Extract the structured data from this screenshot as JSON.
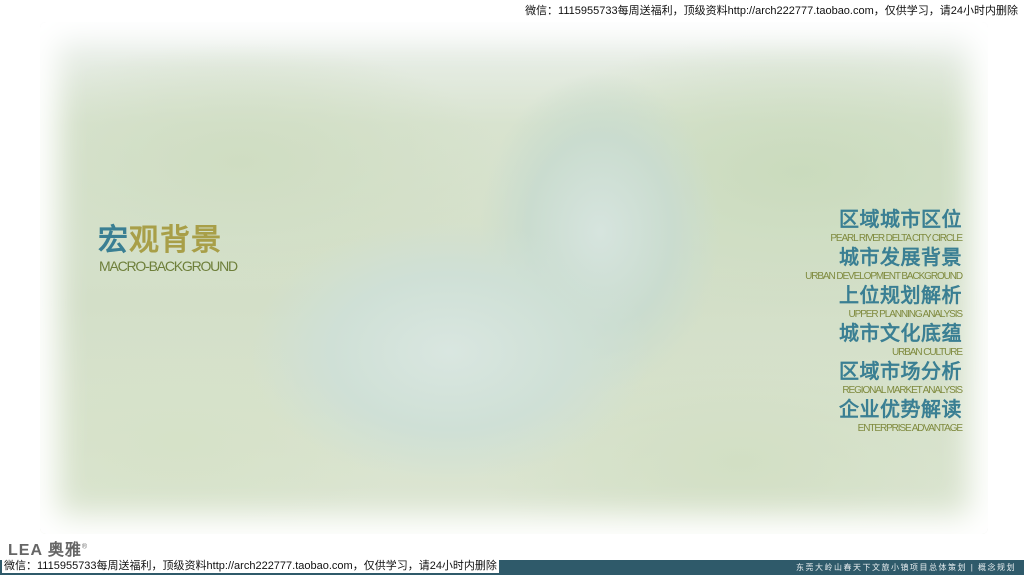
{
  "top_banner": "微信：1115955733每周送福利，顶级资料http://arch222777.taobao.com，仅供学习，请24小时内删除",
  "section": {
    "title_first": "宏",
    "title_rest": "观背景",
    "subtitle": "MACRO-BACKGROUND"
  },
  "menu": [
    {
      "zh": "区域城市区位",
      "en": "Pearl River Delta City Circle"
    },
    {
      "zh": "城市发展背景",
      "en": "Urban development background"
    },
    {
      "zh": "上位规划解析",
      "en": "Upper planning analysis"
    },
    {
      "zh": "城市文化底蕴",
      "en": "Urban culture"
    },
    {
      "zh": "区域市场分析",
      "en": "Regional market analysis"
    },
    {
      "zh": "企业优势解读",
      "en": "Enterprise advantage"
    }
  ],
  "logo": {
    "text": "LEA 奥雅",
    "mark": "®"
  },
  "footer": {
    "project": "东莞大岭山春天下文旅小镇项目总体策划",
    "separator": "|",
    "doc_type": "概念规划"
  },
  "bottom_banner": "微信：1115955733每周送福利，顶级资料http://arch222777.taobao.com，仅供学习，请24小时内删除"
}
